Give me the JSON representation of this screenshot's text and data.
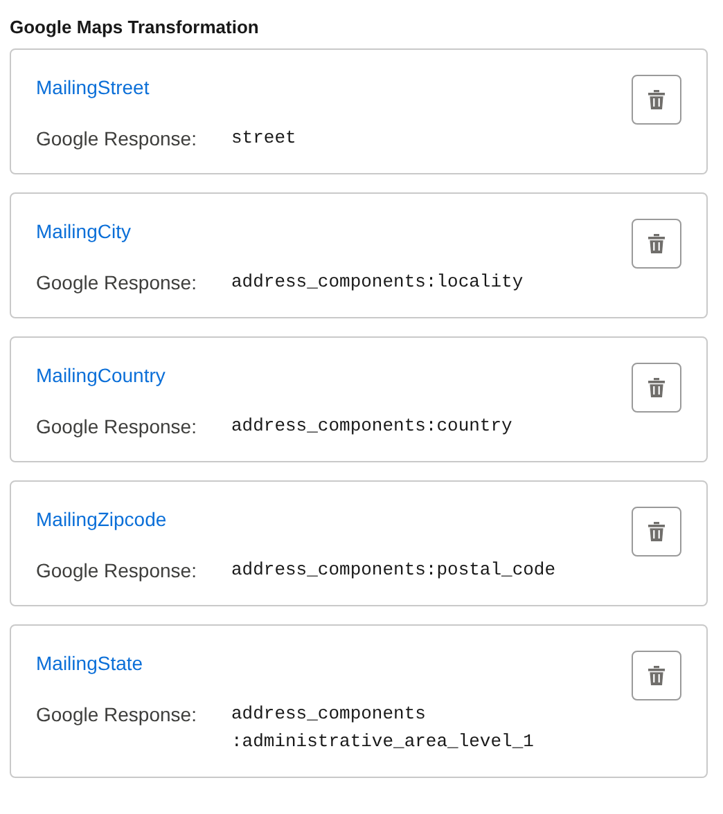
{
  "section": {
    "title": "Google Maps Transformation"
  },
  "mappings": [
    {
      "field": "MailingStreet",
      "label": "Google Response:",
      "value_lines": [
        "street"
      ]
    },
    {
      "field": "MailingCity",
      "label": "Google Response:",
      "value_lines": [
        "address_components:locality"
      ]
    },
    {
      "field": "MailingCountry",
      "label": "Google Response:",
      "value_lines": [
        "address_components:country"
      ]
    },
    {
      "field": "MailingZipcode",
      "label": "Google Response:",
      "value_lines": [
        "address_components:postal_code"
      ]
    },
    {
      "field": "MailingState",
      "label": "Google Response:",
      "value_lines": [
        "address_components",
        ":administrative_area_level_1"
      ]
    }
  ]
}
